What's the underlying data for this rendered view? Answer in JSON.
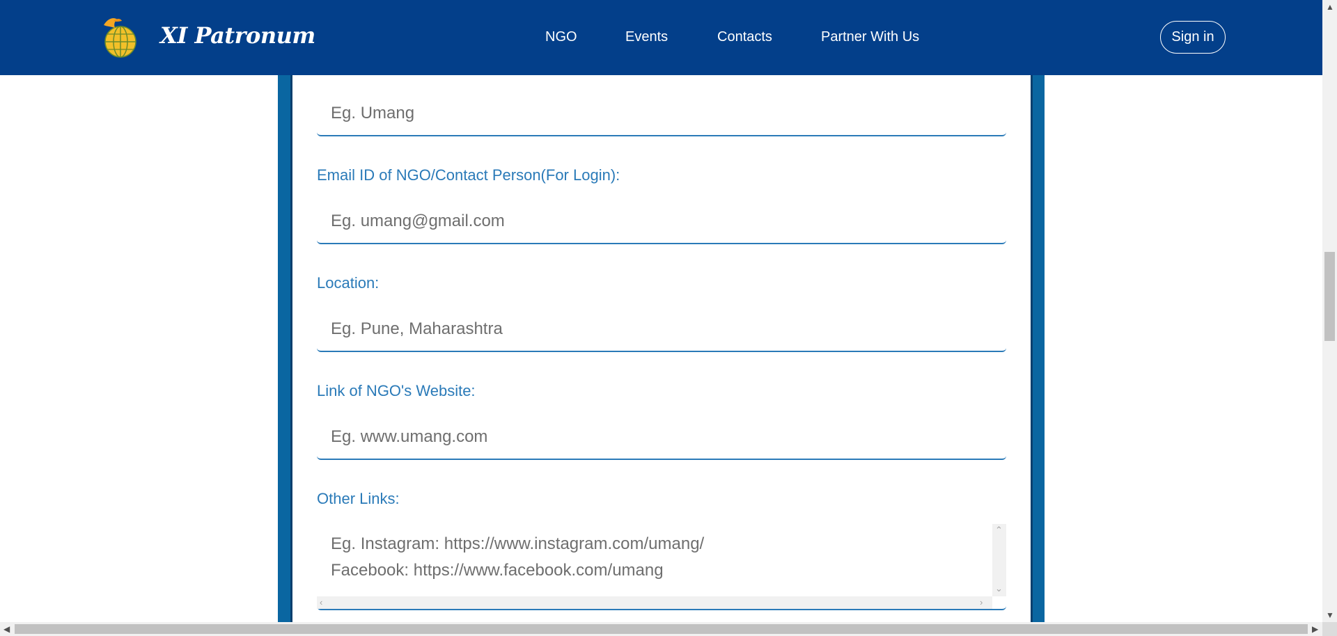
{
  "navbar": {
    "brand_name": "XI Patronum",
    "links": [
      "NGO",
      "Events",
      "Contacts",
      "Partner With Us"
    ],
    "signin_label": "Sign in"
  },
  "form": {
    "fields": [
      {
        "label": "",
        "placeholder": "Eg. Umang"
      },
      {
        "label": "Email ID of NGO/Contact Person(For Login):",
        "placeholder": "Eg. umang@gmail.com"
      },
      {
        "label": "Location:",
        "placeholder": "Eg. Pune, Maharashtra"
      },
      {
        "label": "Link of NGO's Website:",
        "placeholder": "Eg. www.umang.com"
      }
    ],
    "other_links": {
      "label": "Other Links:",
      "placeholder": "Eg. Instagram: https://www.instagram.com/umang/\nFacebook: https://www.facebook.com/umang"
    }
  },
  "icons": {
    "brand_logo": "globe-dove-logo",
    "scroll_up": "chevron-up-icon",
    "scroll_down": "chevron-down-icon",
    "scroll_left": "chevron-left-icon",
    "scroll_right": "chevron-right-icon"
  },
  "colors": {
    "navbar_bg": "#033f8a",
    "label_color": "#2a7ab8",
    "frame_color": "#0a66a1"
  }
}
